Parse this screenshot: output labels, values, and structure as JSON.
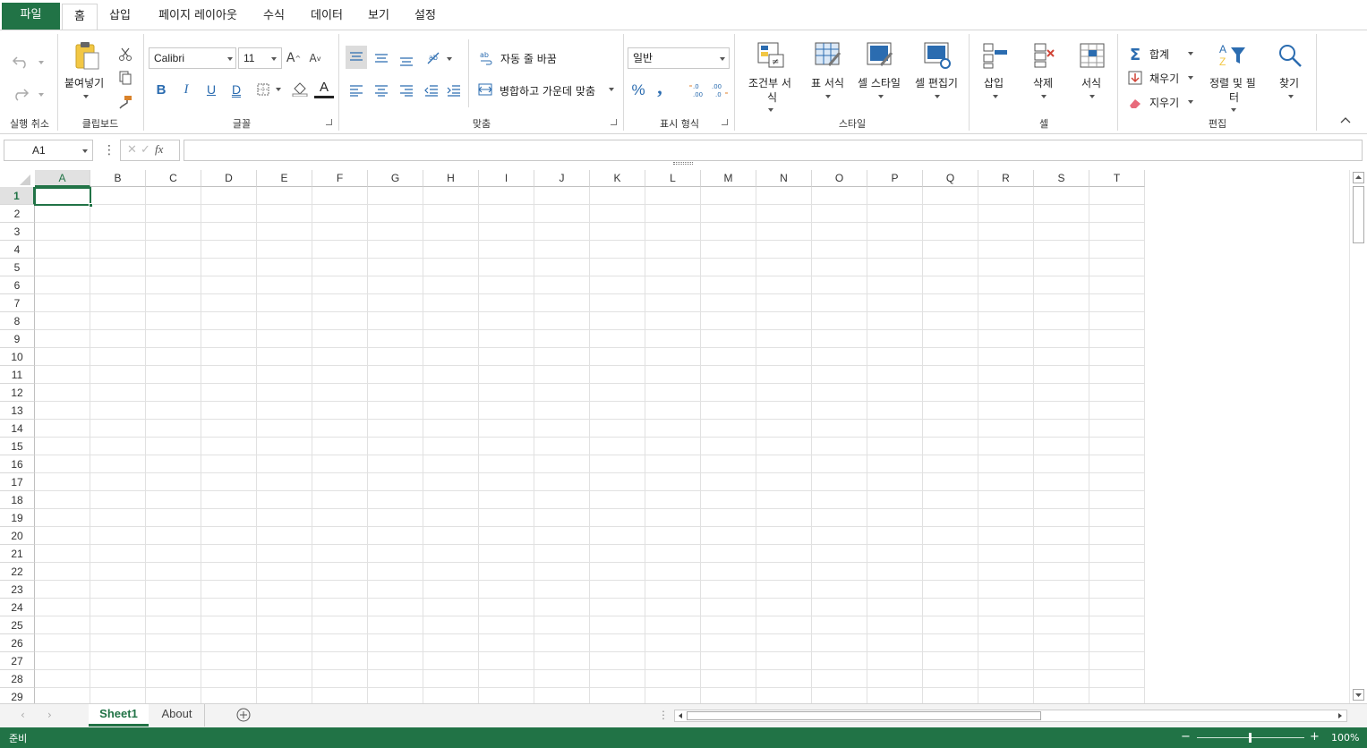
{
  "tabs": {
    "file": "파일",
    "home": "홈",
    "insert": "삽입",
    "page_layout": "페이지 레이아웃",
    "formulas": "수식",
    "data": "데이터",
    "view": "보기",
    "settings": "설정"
  },
  "ribbon": {
    "undo_group": "실행 취소",
    "clipboard": {
      "paste": "붙여넣기",
      "group": "클립보드"
    },
    "font": {
      "name": "Calibri",
      "size": "11",
      "group": "글꼴",
      "bold": "B",
      "italic": "I",
      "underline": "U",
      "double_underline": "D",
      "font_color": "A"
    },
    "alignment": {
      "wrap_text": "자동 줄 바꿈",
      "merge_center": "병합하고 가운데 맞춤",
      "group": "맞춤"
    },
    "number": {
      "format": "일반",
      "percent": "%",
      "comma": ",",
      "group": "표시 형식"
    },
    "styles": {
      "conditional_1": "조건부 서",
      "conditional_2": "식",
      "format_table": "표 서식",
      "cell_style": "셀 스타일",
      "cell_editor": "셀 편집기",
      "group": "스타일"
    },
    "cells": {
      "insert": "삽입",
      "delete": "삭제",
      "format": "서식",
      "group": "셀"
    },
    "editing": {
      "sum": "합계",
      "fill": "채우기",
      "clear": "지우기",
      "sort_1": "정렬 및 필",
      "sort_2": "터",
      "find": "찾기",
      "group": "편집"
    }
  },
  "formula_bar": {
    "name_box": "A1",
    "fx": "fx",
    "value": ""
  },
  "columns": [
    "A",
    "B",
    "C",
    "D",
    "E",
    "F",
    "G",
    "H",
    "I",
    "J",
    "K",
    "L",
    "M",
    "N",
    "O",
    "P",
    "Q",
    "R",
    "S",
    "T"
  ],
  "rows": [
    "1",
    "2",
    "3",
    "4",
    "5",
    "6",
    "7",
    "8",
    "9",
    "10",
    "11",
    "12",
    "13",
    "14",
    "15",
    "16",
    "17",
    "18",
    "19",
    "20",
    "21",
    "22",
    "23",
    "24",
    "25",
    "26",
    "27",
    "28",
    "29"
  ],
  "sheets": [
    {
      "name": "Sheet1",
      "active": true
    },
    {
      "name": "About",
      "active": false
    }
  ],
  "status": {
    "ready": "준비",
    "zoom": "100%"
  },
  "colors": {
    "accent": "#217346",
    "selection": "#217346"
  }
}
